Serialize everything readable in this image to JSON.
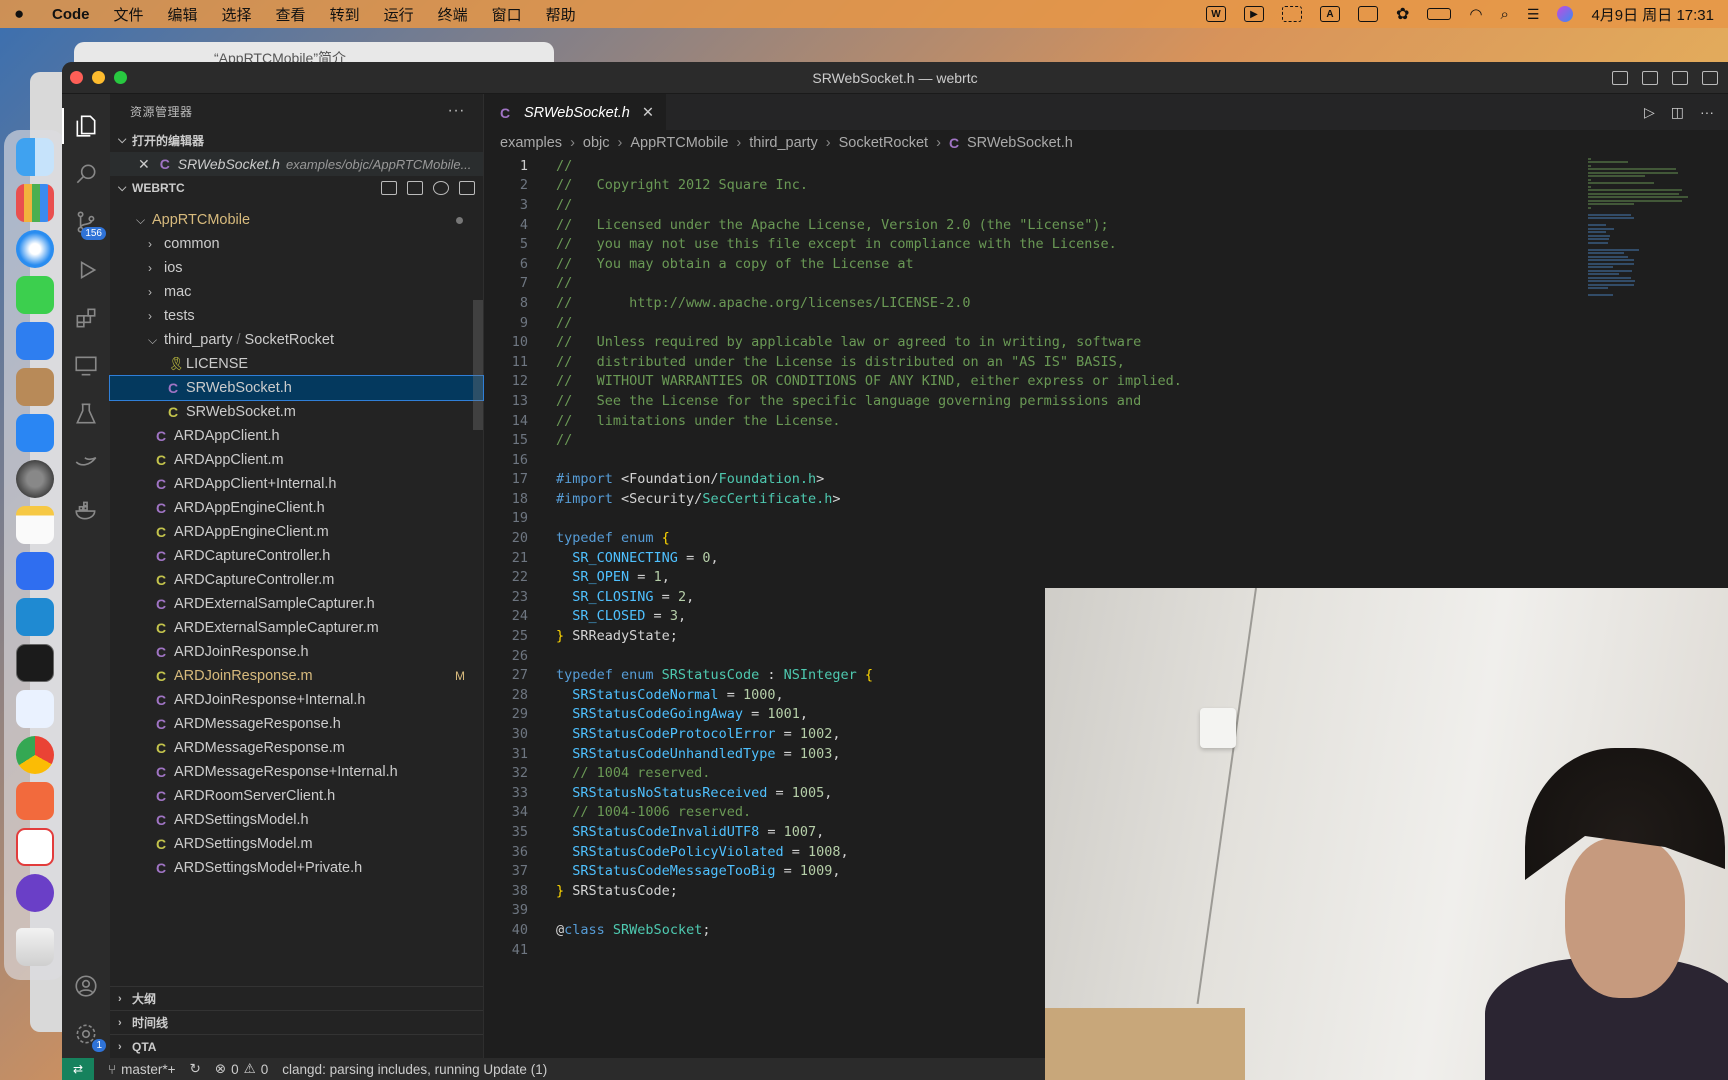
{
  "menubar": {
    "app_name": "Code",
    "items": [
      "文件",
      "编辑",
      "选择",
      "查看",
      "转到",
      "运行",
      "终端",
      "窗口",
      "帮助"
    ],
    "clock": "4月9日 周日 17:31",
    "input_indicator": "A"
  },
  "background_window": {
    "title": "“AppRTCMobile”简介"
  },
  "window": {
    "title": "SRWebSocket.h — webrtc"
  },
  "activity": {
    "scm_badge": "156",
    "settings_badge": "1"
  },
  "sidebar": {
    "header": "资源管理器",
    "open_editors_label": "打开的编辑器",
    "open_editor": {
      "name": "SRWebSocket.h",
      "path": "examples/objc/AppRTCMobile..."
    },
    "workspace_label": "WEBRTC",
    "tree": [
      {
        "name": "AppRTCMobile",
        "kind": "folder-open",
        "indent": 1
      },
      {
        "name": "common",
        "kind": "folder",
        "indent": 2
      },
      {
        "name": "ios",
        "kind": "folder",
        "indent": 2
      },
      {
        "name": "mac",
        "kind": "folder",
        "indent": 2
      },
      {
        "name": "tests",
        "kind": "folder",
        "indent": 2
      },
      {
        "name": "third_party",
        "name2": "SocketRocket",
        "kind": "folder-open",
        "indent": 2
      },
      {
        "name": "LICENSE",
        "kind": "license",
        "indent": 3
      },
      {
        "name": "SRWebSocket.h",
        "kind": "h",
        "indent": 3,
        "selected": true
      },
      {
        "name": "SRWebSocket.m",
        "kind": "m",
        "indent": 3
      },
      {
        "name": "ARDAppClient.h",
        "kind": "h",
        "indent": 2
      },
      {
        "name": "ARDAppClient.m",
        "kind": "m",
        "indent": 2
      },
      {
        "name": "ARDAppClient+Internal.h",
        "kind": "h",
        "indent": 2
      },
      {
        "name": "ARDAppEngineClient.h",
        "kind": "h",
        "indent": 2
      },
      {
        "name": "ARDAppEngineClient.m",
        "kind": "m",
        "indent": 2
      },
      {
        "name": "ARDCaptureController.h",
        "kind": "h",
        "indent": 2
      },
      {
        "name": "ARDCaptureController.m",
        "kind": "m",
        "indent": 2
      },
      {
        "name": "ARDExternalSampleCapturer.h",
        "kind": "h",
        "indent": 2
      },
      {
        "name": "ARDExternalSampleCapturer.m",
        "kind": "m",
        "indent": 2
      },
      {
        "name": "ARDJoinResponse.h",
        "kind": "h",
        "indent": 2
      },
      {
        "name": "ARDJoinResponse.m",
        "kind": "m",
        "indent": 2,
        "modified": "M"
      },
      {
        "name": "ARDJoinResponse+Internal.h",
        "kind": "h",
        "indent": 2
      },
      {
        "name": "ARDMessageResponse.h",
        "kind": "h",
        "indent": 2
      },
      {
        "name": "ARDMessageResponse.m",
        "kind": "m",
        "indent": 2
      },
      {
        "name": "ARDMessageResponse+Internal.h",
        "kind": "h",
        "indent": 2
      },
      {
        "name": "ARDRoomServerClient.h",
        "kind": "h",
        "indent": 2
      },
      {
        "name": "ARDSettingsModel.h",
        "kind": "h",
        "indent": 2
      },
      {
        "name": "ARDSettingsModel.m",
        "kind": "m",
        "indent": 2
      },
      {
        "name": "ARDSettingsModel+Private.h",
        "kind": "h",
        "indent": 2
      }
    ],
    "bottom_sections": [
      "大纲",
      "时间线",
      "QTA"
    ]
  },
  "editor": {
    "tab": {
      "label": "SRWebSocket.h"
    },
    "breadcrumb": [
      "examples",
      "objc",
      "AppRTCMobile",
      "third_party",
      "SocketRocket",
      "SRWebSocket.h"
    ],
    "lines": [
      [
        [
          "comment",
          "//"
        ]
      ],
      [
        [
          "comment",
          "//   Copyright 2012 Square Inc."
        ]
      ],
      [
        [
          "comment",
          "//"
        ]
      ],
      [
        [
          "comment",
          "//   Licensed under the Apache License, Version 2.0 (the \"License\");"
        ]
      ],
      [
        [
          "comment",
          "//   you may not use this file except in compliance with the License."
        ]
      ],
      [
        [
          "comment",
          "//   You may obtain a copy of the License at"
        ]
      ],
      [
        [
          "comment",
          "//"
        ]
      ],
      [
        [
          "comment",
          "//       http://www.apache.org/licenses/LICENSE-2.0"
        ]
      ],
      [
        [
          "comment",
          "//"
        ]
      ],
      [
        [
          "comment",
          "//   Unless required by applicable law or agreed to in writing, software"
        ]
      ],
      [
        [
          "comment",
          "//   distributed under the License is distributed on an \"AS IS\" BASIS,"
        ]
      ],
      [
        [
          "comment",
          "//   WITHOUT WARRANTIES OR CONDITIONS OF ANY KIND, either express or implied."
        ]
      ],
      [
        [
          "comment",
          "//   See the License for the specific language governing permissions and"
        ]
      ],
      [
        [
          "comment",
          "//   limitations under the License."
        ]
      ],
      [
        [
          "comment",
          "//"
        ]
      ],
      [],
      [
        [
          "pp",
          "#import "
        ],
        [
          "plain",
          "<Foundation/"
        ],
        [
          "type",
          "Foundation.h"
        ],
        [
          "plain",
          ">"
        ]
      ],
      [
        [
          "pp",
          "#import "
        ],
        [
          "plain",
          "<Security/"
        ],
        [
          "type",
          "SecCertificate.h"
        ],
        [
          "plain",
          ">"
        ]
      ],
      [],
      [
        [
          "kw",
          "typedef enum "
        ],
        [
          "brace",
          "{"
        ]
      ],
      [
        [
          "plain",
          "  "
        ],
        [
          "enum",
          "SR_CONNECTING"
        ],
        [
          "plain",
          " = "
        ],
        [
          "num",
          "0"
        ],
        [
          "plain",
          ","
        ]
      ],
      [
        [
          "plain",
          "  "
        ],
        [
          "enum",
          "SR_OPEN"
        ],
        [
          "plain",
          " = "
        ],
        [
          "num",
          "1"
        ],
        [
          "plain",
          ","
        ]
      ],
      [
        [
          "plain",
          "  "
        ],
        [
          "enum",
          "SR_CLOSING"
        ],
        [
          "plain",
          " = "
        ],
        [
          "num",
          "2"
        ],
        [
          "plain",
          ","
        ]
      ],
      [
        [
          "plain",
          "  "
        ],
        [
          "enum",
          "SR_CLOSED"
        ],
        [
          "plain",
          " = "
        ],
        [
          "num",
          "3"
        ],
        [
          "plain",
          ","
        ]
      ],
      [
        [
          "brace",
          "}"
        ],
        [
          "plain",
          " SRReadyState;"
        ]
      ],
      [],
      [
        [
          "kw",
          "typedef enum "
        ],
        [
          "type",
          "SRStatusCode"
        ],
        [
          "plain",
          " : "
        ],
        [
          "type",
          "NSInteger"
        ],
        [
          "plain",
          " "
        ],
        [
          "brace",
          "{"
        ]
      ],
      [
        [
          "plain",
          "  "
        ],
        [
          "enum",
          "SRStatusCodeNormal"
        ],
        [
          "plain",
          " = "
        ],
        [
          "num",
          "1000"
        ],
        [
          "plain",
          ","
        ]
      ],
      [
        [
          "plain",
          "  "
        ],
        [
          "enum",
          "SRStatusCodeGoingAway"
        ],
        [
          "plain",
          " = "
        ],
        [
          "num",
          "1001"
        ],
        [
          "plain",
          ","
        ]
      ],
      [
        [
          "plain",
          "  "
        ],
        [
          "enum",
          "SRStatusCodeProtocolError"
        ],
        [
          "plain",
          " = "
        ],
        [
          "num",
          "1002"
        ],
        [
          "plain",
          ","
        ]
      ],
      [
        [
          "plain",
          "  "
        ],
        [
          "enum",
          "SRStatusCodeUnhandledType"
        ],
        [
          "plain",
          " = "
        ],
        [
          "num",
          "1003"
        ],
        [
          "plain",
          ","
        ]
      ],
      [
        [
          "plain",
          "  "
        ],
        [
          "comment",
          "// 1004 reserved."
        ]
      ],
      [
        [
          "plain",
          "  "
        ],
        [
          "enum",
          "SRStatusNoStatusReceived"
        ],
        [
          "plain",
          " = "
        ],
        [
          "num",
          "1005"
        ],
        [
          "plain",
          ","
        ]
      ],
      [
        [
          "plain",
          "  "
        ],
        [
          "comment",
          "// 1004-1006 reserved."
        ]
      ],
      [
        [
          "plain",
          "  "
        ],
        [
          "enum",
          "SRStatusCodeInvalidUTF8"
        ],
        [
          "plain",
          " = "
        ],
        [
          "num",
          "1007"
        ],
        [
          "plain",
          ","
        ]
      ],
      [
        [
          "plain",
          "  "
        ],
        [
          "enum",
          "SRStatusCodePolicyViolated"
        ],
        [
          "plain",
          " = "
        ],
        [
          "num",
          "1008"
        ],
        [
          "plain",
          ","
        ]
      ],
      [
        [
          "plain",
          "  "
        ],
        [
          "enum",
          "SRStatusCodeMessageTooBig"
        ],
        [
          "plain",
          " = "
        ],
        [
          "num",
          "1009"
        ],
        [
          "plain",
          ","
        ]
      ],
      [
        [
          "brace",
          "}"
        ],
        [
          "plain",
          " SRStatusCode;"
        ]
      ],
      [],
      [
        [
          "plain",
          "@"
        ],
        [
          "kw",
          "class "
        ],
        [
          "type",
          "SRWebSocket"
        ],
        [
          "plain",
          ";"
        ]
      ],
      []
    ]
  },
  "statusbar": {
    "branch": "master*+",
    "errors": "0",
    "warnings": "0",
    "message": "clangd: parsing includes, running Update (1)"
  },
  "colors": {
    "accent": "#2f7fd8",
    "selection": "#04395e",
    "comment": "#6a9955",
    "keyword": "#569cd6"
  }
}
